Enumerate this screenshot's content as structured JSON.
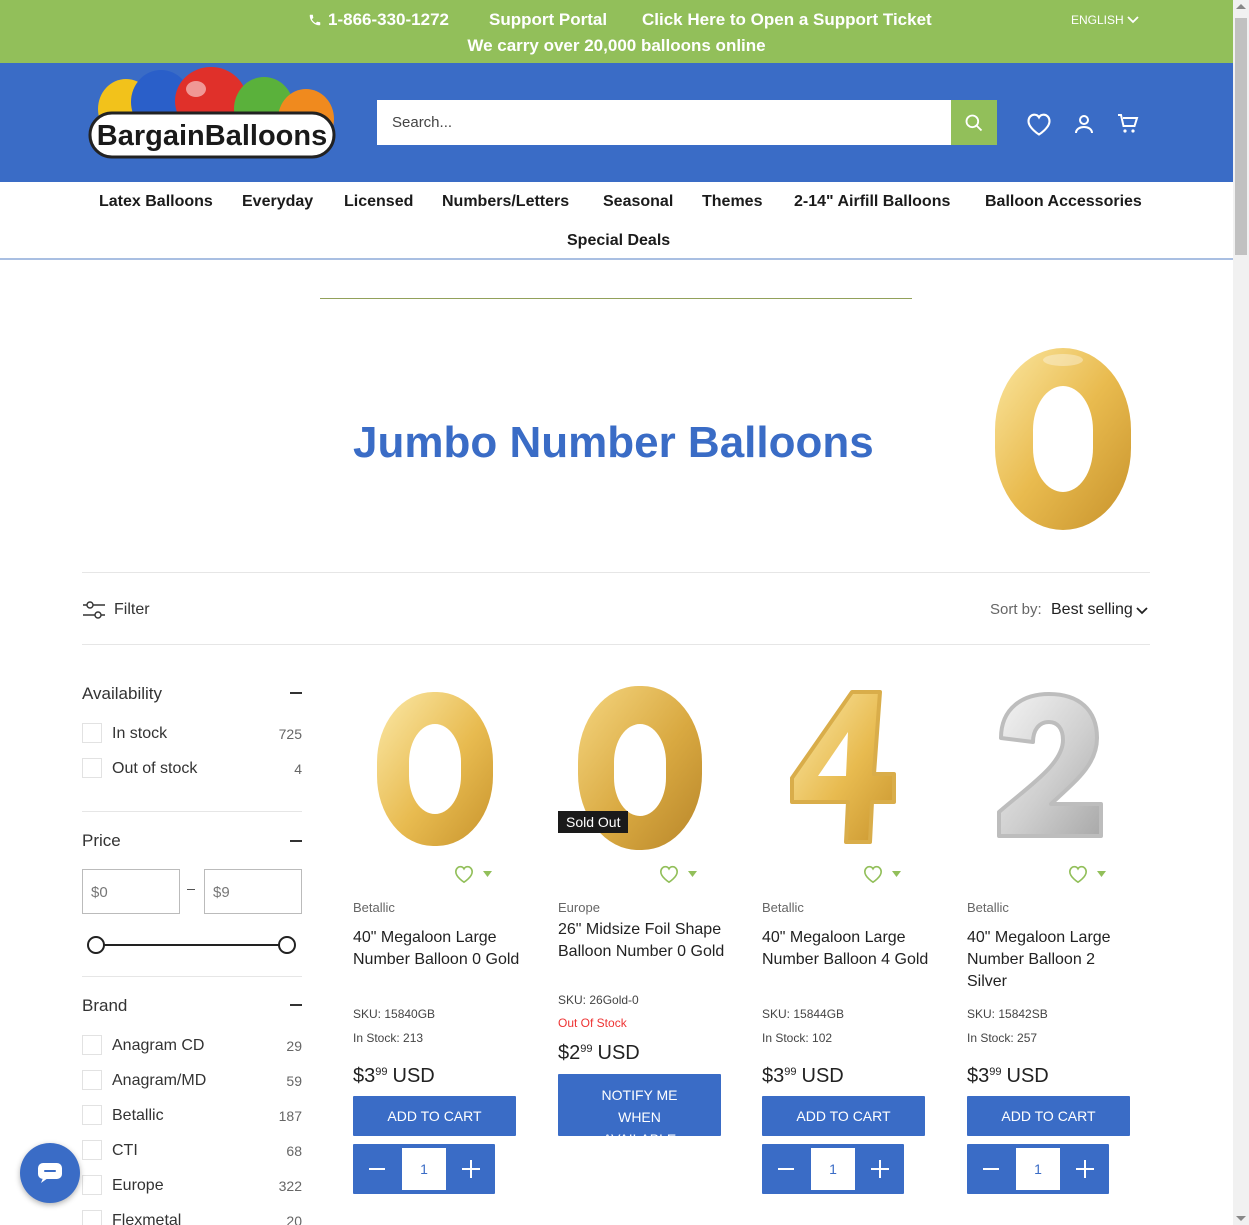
{
  "announcement": {
    "phone": "1-866-330-1272",
    "support_portal": "Support Portal",
    "ticket": "Click Here to Open a Support Ticket",
    "language": "ENGLISH",
    "tagline": "We carry over 20,000 balloons online"
  },
  "header": {
    "logo_text": "BargainBalloons",
    "search_placeholder": "Search...",
    "icons": [
      "wishlist-heart-icon",
      "account-icon",
      "cart-icon"
    ]
  },
  "nav": {
    "items": [
      "Latex Balloons",
      "Everyday",
      "Licensed",
      "Numbers/Letters",
      "Seasonal",
      "Themes",
      "2-14\" Airfill Balloons",
      "Balloon Accessories",
      "Special Deals"
    ]
  },
  "collection": {
    "title": "Jumbo Number Balloons"
  },
  "toolbar": {
    "filter_label": "Filter",
    "sort_label": "Sort by:",
    "sort_value": "Best selling"
  },
  "facets": {
    "availability": {
      "title": "Availability",
      "options": [
        {
          "label": "In stock",
          "count": "725"
        },
        {
          "label": "Out of stock",
          "count": "4"
        }
      ]
    },
    "price": {
      "title": "Price",
      "min_placeholder": "$0",
      "max_placeholder": "$9"
    },
    "brand": {
      "title": "Brand",
      "options": [
        {
          "label": "Anagram CD",
          "count": "29"
        },
        {
          "label": "Anagram/MD",
          "count": "59"
        },
        {
          "label": "Betallic",
          "count": "187"
        },
        {
          "label": "CTI",
          "count": "68"
        },
        {
          "label": "Europe",
          "count": "322"
        },
        {
          "label": "Flexmetal",
          "count": "20"
        }
      ]
    }
  },
  "products": [
    {
      "vendor": "Betallic",
      "title": "40\" Megaloon Large Number Balloon 0 Gold",
      "sku": "SKU: 15840GB",
      "stock": "In Stock: 213",
      "price_int": "$3",
      "price_dec": "99",
      "currency": "USD",
      "button": "ADD TO CART",
      "qty": "1",
      "digit": "0",
      "color": "gold"
    },
    {
      "vendor": "Europe",
      "title": "26\" Midsize Foil Shape Balloon Number 0 Gold",
      "sku": "SKU: 26Gold-0",
      "stock": "Out Of Stock",
      "price_int": "$2",
      "price_dec": "99",
      "currency": "USD",
      "button": "NOTIFY ME WHEN AVAILABLE",
      "badge": "Sold Out",
      "digit": "0",
      "color": "gold"
    },
    {
      "vendor": "Betallic",
      "title": "40\" Megaloon Large Number Balloon 4 Gold",
      "sku": "SKU: 15844GB",
      "stock": "In Stock: 102",
      "price_int": "$3",
      "price_dec": "99",
      "currency": "USD",
      "button": "ADD TO CART",
      "qty": "1",
      "digit": "4",
      "color": "gold"
    },
    {
      "vendor": "Betallic",
      "title": "40\" Megaloon Large Number Balloon 2 Silver",
      "sku": "SKU: 15842SB",
      "stock": "In Stock: 257",
      "price_int": "$3",
      "price_dec": "99",
      "currency": "USD",
      "button": "ADD TO CART",
      "qty": "1",
      "digit": "2",
      "color": "silver"
    }
  ],
  "colors": {
    "brand_green": "#92bf5a",
    "brand_blue": "#3a6cc6",
    "error_red": "#e33333"
  }
}
